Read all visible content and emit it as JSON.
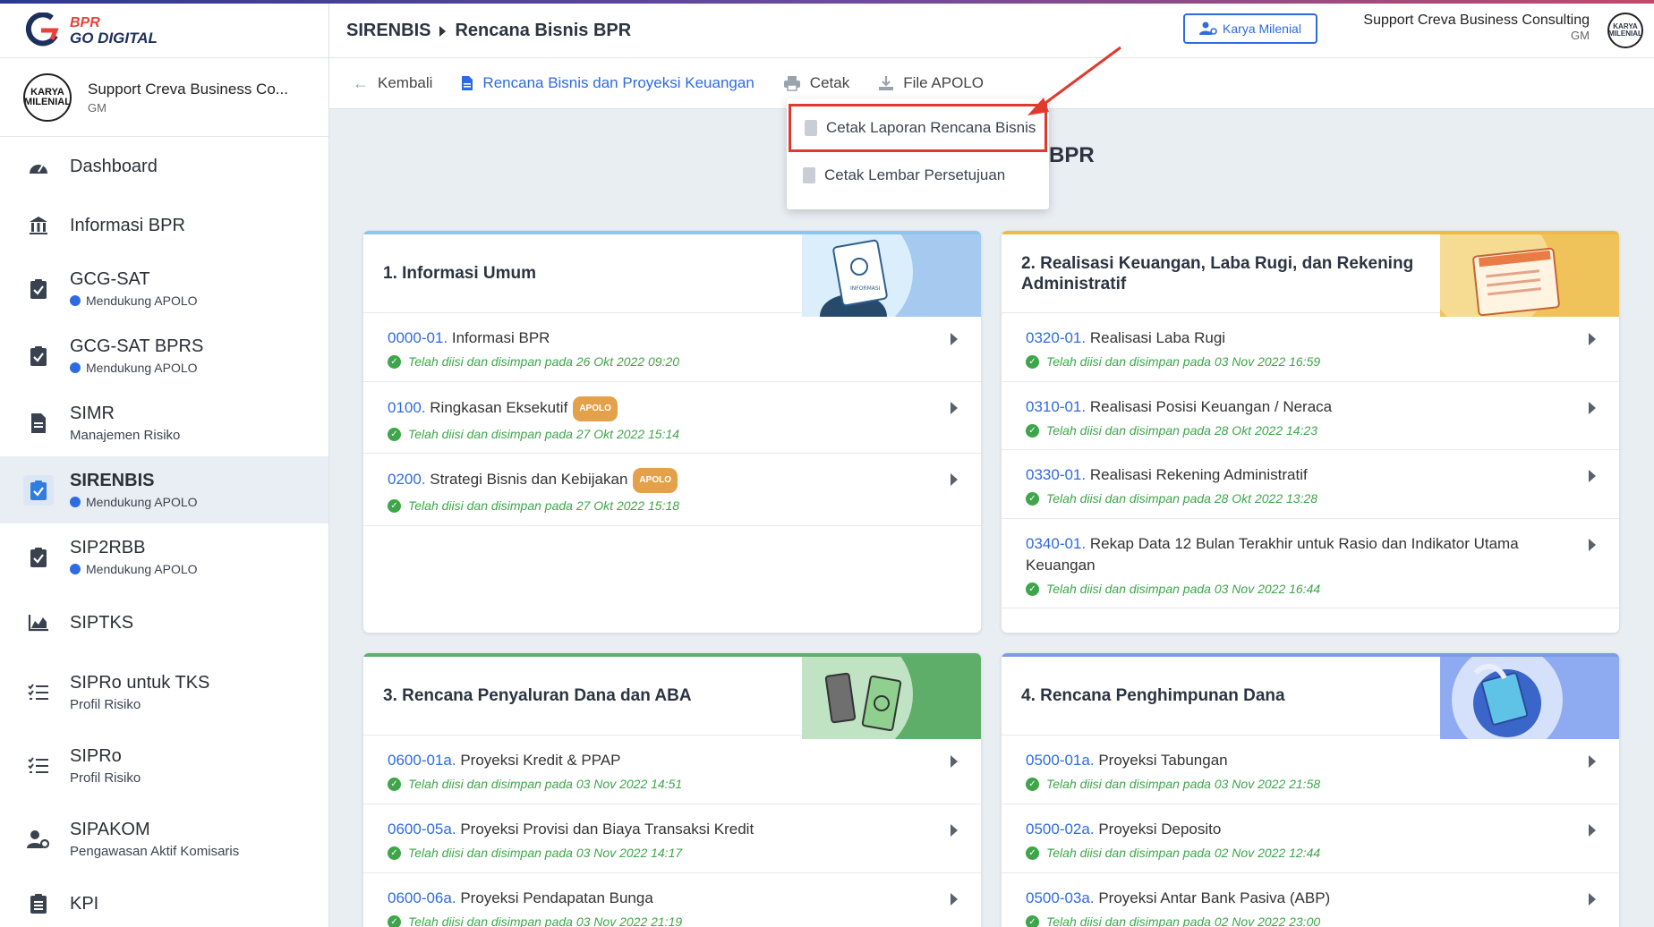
{
  "logo": {
    "line1": "BPR",
    "line2": "GO DIGITAL"
  },
  "profile": {
    "avatar_text": "KARYA MILENIAL",
    "name": "Support Creva Business Co...",
    "role": "GM"
  },
  "sidebar": {
    "items": [
      {
        "label": "Dashboard",
        "icon": "dashboard-icon"
      },
      {
        "label": "Informasi BPR",
        "icon": "bank-icon"
      },
      {
        "label": "GCG-SAT",
        "sub": "Mendukung APOLO",
        "icon": "clipboard-check-icon"
      },
      {
        "label": "GCG-SAT BPRS",
        "sub": "Mendukung APOLO",
        "icon": "clipboard-check-icon"
      },
      {
        "label": "SIMR",
        "sub": "Manajemen Risiko",
        "icon": "document-icon"
      },
      {
        "label": "SIRENBIS",
        "sub": "Mendukung APOLO",
        "icon": "clipboard-check-icon",
        "active": true
      },
      {
        "label": "SIP2RBB",
        "sub": "Mendukung APOLO",
        "icon": "clipboard-check-icon"
      },
      {
        "label": "SIPTKS",
        "icon": "area-chart-icon"
      },
      {
        "label": "SIPRo untuk TKS",
        "sub": "Profil Risiko",
        "icon": "checklist-icon"
      },
      {
        "label": "SIPRo",
        "sub": "Profil Risiko",
        "icon": "checklist-icon"
      },
      {
        "label": "SIPAKOM",
        "sub": "Pengawasan Aktif Komisaris",
        "icon": "user-gear-icon"
      },
      {
        "label": "KPI",
        "icon": "clipboard-list-icon"
      }
    ]
  },
  "header": {
    "breadcrumb_root": "SIRENBIS",
    "breadcrumb_page": "Rencana Bisnis BPR",
    "karya_button": "Karya Milenial",
    "user_name": "Support Creva Business Consulting",
    "user_role": "GM",
    "avatar_text": "KARYA MILENIAL"
  },
  "toolbar": {
    "back": "Kembali",
    "rencana": "Rencana Bisnis dan Proyeksi Keuangan",
    "cetak": "Cetak",
    "file_apolo": "File APOLO"
  },
  "dropdown": {
    "item1": "Cetak Laporan Rencana Bisnis",
    "item2": "Cetak Lembar Persetujuan"
  },
  "content_title_visible": "BPR",
  "cards": {
    "c1": {
      "title": "1. Informasi Umum",
      "rows": [
        {
          "code": "0000-01.",
          "label": "Informasi BPR",
          "status": "Telah diisi dan disimpan pada 26 Okt 2022 09:20"
        },
        {
          "code": "0100.",
          "label": "Ringkasan Eksekutif",
          "badge": "APOLO",
          "status": "Telah diisi dan disimpan pada 27 Okt 2022 15:14"
        },
        {
          "code": "0200.",
          "label": "Strategi Bisnis dan Kebijakan",
          "badge": "APOLO",
          "status": "Telah diisi dan disimpan pada 27 Okt 2022 15:18"
        }
      ]
    },
    "c2": {
      "title": "2. Realisasi Keuangan, Laba Rugi, dan Rekening Administratif",
      "rows": [
        {
          "code": "0320-01.",
          "label": "Realisasi Laba Rugi",
          "status": "Telah diisi dan disimpan pada 03 Nov 2022 16:59"
        },
        {
          "code": "0310-01.",
          "label": "Realisasi Posisi Keuangan / Neraca",
          "status": "Telah diisi dan disimpan pada 28 Okt 2022 14:23"
        },
        {
          "code": "0330-01.",
          "label": "Realisasi Rekening Administratif",
          "status": "Telah diisi dan disimpan pada 28 Okt 2022 13:28"
        },
        {
          "code": "0340-01.",
          "label": "Rekap Data 12 Bulan Terakhir untuk Rasio dan Indikator Utama Keuangan",
          "status": "Telah diisi dan disimpan pada 03 Nov 2022 16:44"
        }
      ]
    },
    "c3": {
      "title": "3. Rencana Penyaluran Dana dan ABA",
      "rows": [
        {
          "code": "0600-01a.",
          "label": "Proyeksi Kredit & PPAP",
          "status": "Telah diisi dan disimpan pada 03 Nov 2022 14:51"
        },
        {
          "code": "0600-05a.",
          "label": "Proyeksi Provisi dan Biaya Transaksi Kredit",
          "status": "Telah diisi dan disimpan pada 03 Nov 2022 14:17"
        },
        {
          "code": "0600-06a.",
          "label": "Proyeksi Pendapatan Bunga",
          "status": "Telah diisi dan disimpan pada 03 Nov 2022 21:19"
        }
      ]
    },
    "c4": {
      "title": "4. Rencana Penghimpunan Dana",
      "rows": [
        {
          "code": "0500-01a.",
          "label": "Proyeksi Tabungan",
          "status": "Telah diisi dan disimpan pada 03 Nov 2022 21:58"
        },
        {
          "code": "0500-02a.",
          "label": "Proyeksi Deposito",
          "status": "Telah diisi dan disimpan pada 02 Nov 2022 12:44"
        },
        {
          "code": "0500-03a.",
          "label": "Proyeksi Antar Bank Pasiva (ABP)",
          "status": "Telah diisi dan disimpan pada 02 Nov 2022 23:00"
        }
      ]
    }
  },
  "illustration_labels": {
    "info": "INFORMASI"
  },
  "colors": {
    "primary": "#2f6be0",
    "success": "#3ea54a",
    "highlight": "#e03a2f",
    "badge": "#e3a24a"
  }
}
